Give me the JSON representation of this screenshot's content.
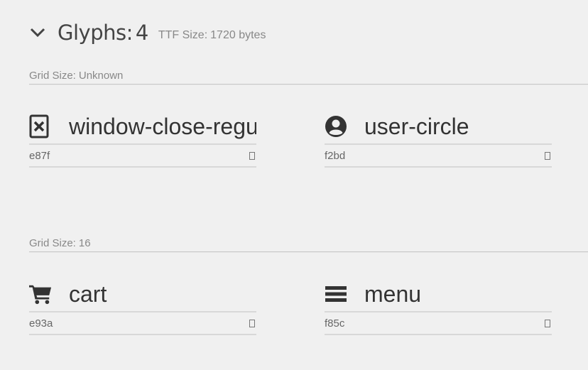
{
  "header": {
    "toggle_icon": "chevron-down-icon",
    "title": "Glyphs:",
    "count": "4",
    "ttf_label": "TTF Size:",
    "ttf_value": "1720 bytes"
  },
  "sections": [
    {
      "label": "Grid Size:",
      "value": "Unknown",
      "glyphs": [
        {
          "icon": "window-close-icon",
          "name": "window-close-regular",
          "code": "e87f"
        },
        {
          "icon": "user-circle-icon",
          "name": "user-circle",
          "code": "f2bd"
        }
      ]
    },
    {
      "label": "Grid Size:",
      "value": "16",
      "glyphs": [
        {
          "icon": "cart-icon",
          "name": "cart",
          "code": "e93a"
        },
        {
          "icon": "menu-icon",
          "name": "menu",
          "code": "f85c"
        }
      ]
    }
  ],
  "colors": {
    "background": "#f0f0f0",
    "text": "#333333",
    "muted": "#888888",
    "rule": "#d8d8d8"
  }
}
